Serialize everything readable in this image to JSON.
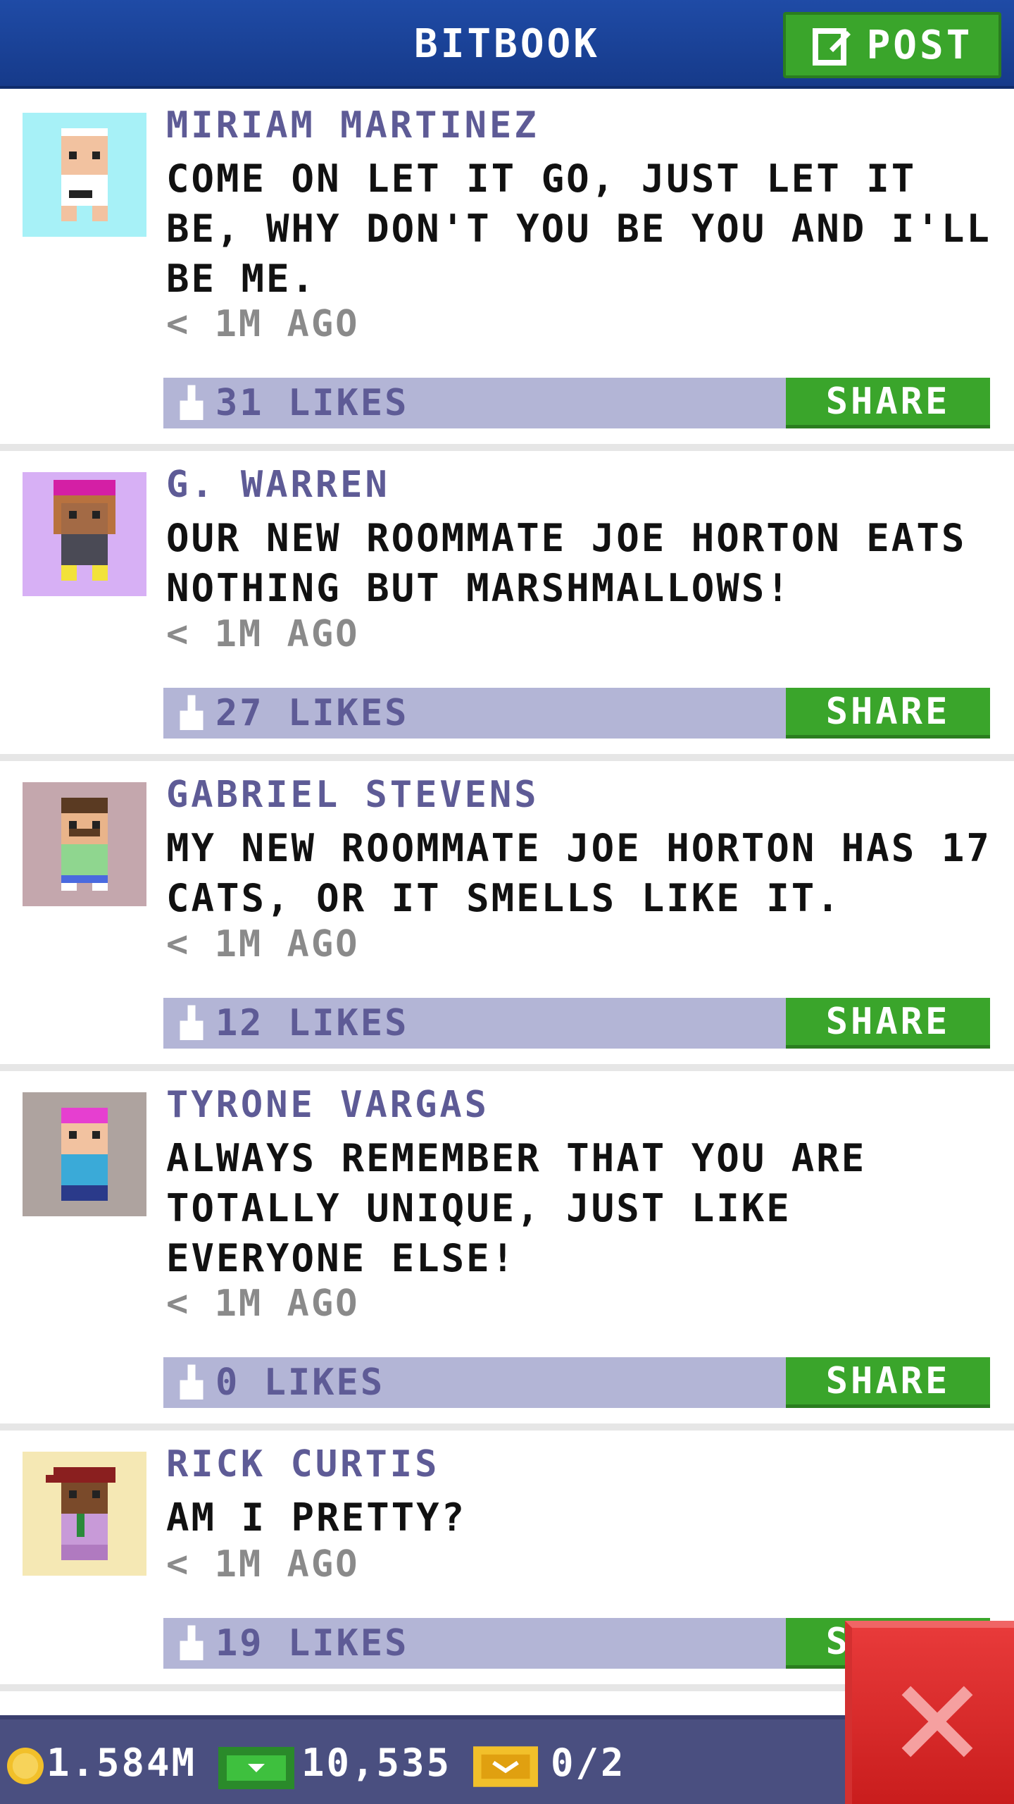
{
  "header": {
    "title": "BITBOOK",
    "post_label": "POST"
  },
  "posts": [
    {
      "author": "MIRIAM MARTINEZ",
      "text": "COME ON LET IT GO, JUST LET IT BE, WHY DON'T YOU BE YOU AND I'LL BE ME.",
      "time": "< 1M AGO",
      "likes": "31 LIKES",
      "share": "SHARE"
    },
    {
      "author": "G. WARREN",
      "text": "OUR NEW ROOMMATE JOE HORTON EATS NOTHING BUT MARSHMALLOWS!",
      "time": "< 1M AGO",
      "likes": "27 LIKES",
      "share": "SHARE"
    },
    {
      "author": "GABRIEL STEVENS",
      "text": "MY NEW ROOMMATE JOE HORTON HAS 17 CATS, OR IT SMELLS LIKE IT.",
      "time": "< 1M AGO",
      "likes": "12 LIKES",
      "share": "SHARE"
    },
    {
      "author": "TYRONE VARGAS",
      "text": "ALWAYS REMEMBER THAT YOU ARE TOTALLY UNIQUE, JUST LIKE EVERYONE ELSE!",
      "time": "< 1M AGO",
      "likes": "0 LIKES",
      "share": "SHARE"
    },
    {
      "author": "RICK CURTIS",
      "text": "AM I PRETTY?",
      "time": "< 1M AGO",
      "likes": "19 LIKES",
      "share": "SHARE"
    }
  ],
  "footer": {
    "coins": "1.584M",
    "bux": "10,535",
    "tickets": "0/2"
  },
  "colors": {
    "header": "#1f4ba6",
    "accent_green": "#3aa52b",
    "likes_bar": "#b3b5d6",
    "author": "#5e5b96",
    "close_red": "#e02b2b",
    "footer": "#4a4f80"
  },
  "icons": {
    "post": "edit-icon",
    "like": "thumbs-up-icon",
    "coin": "coin-icon",
    "bux": "cash-icon",
    "ticket": "ticket-icon",
    "close": "close-icon"
  }
}
